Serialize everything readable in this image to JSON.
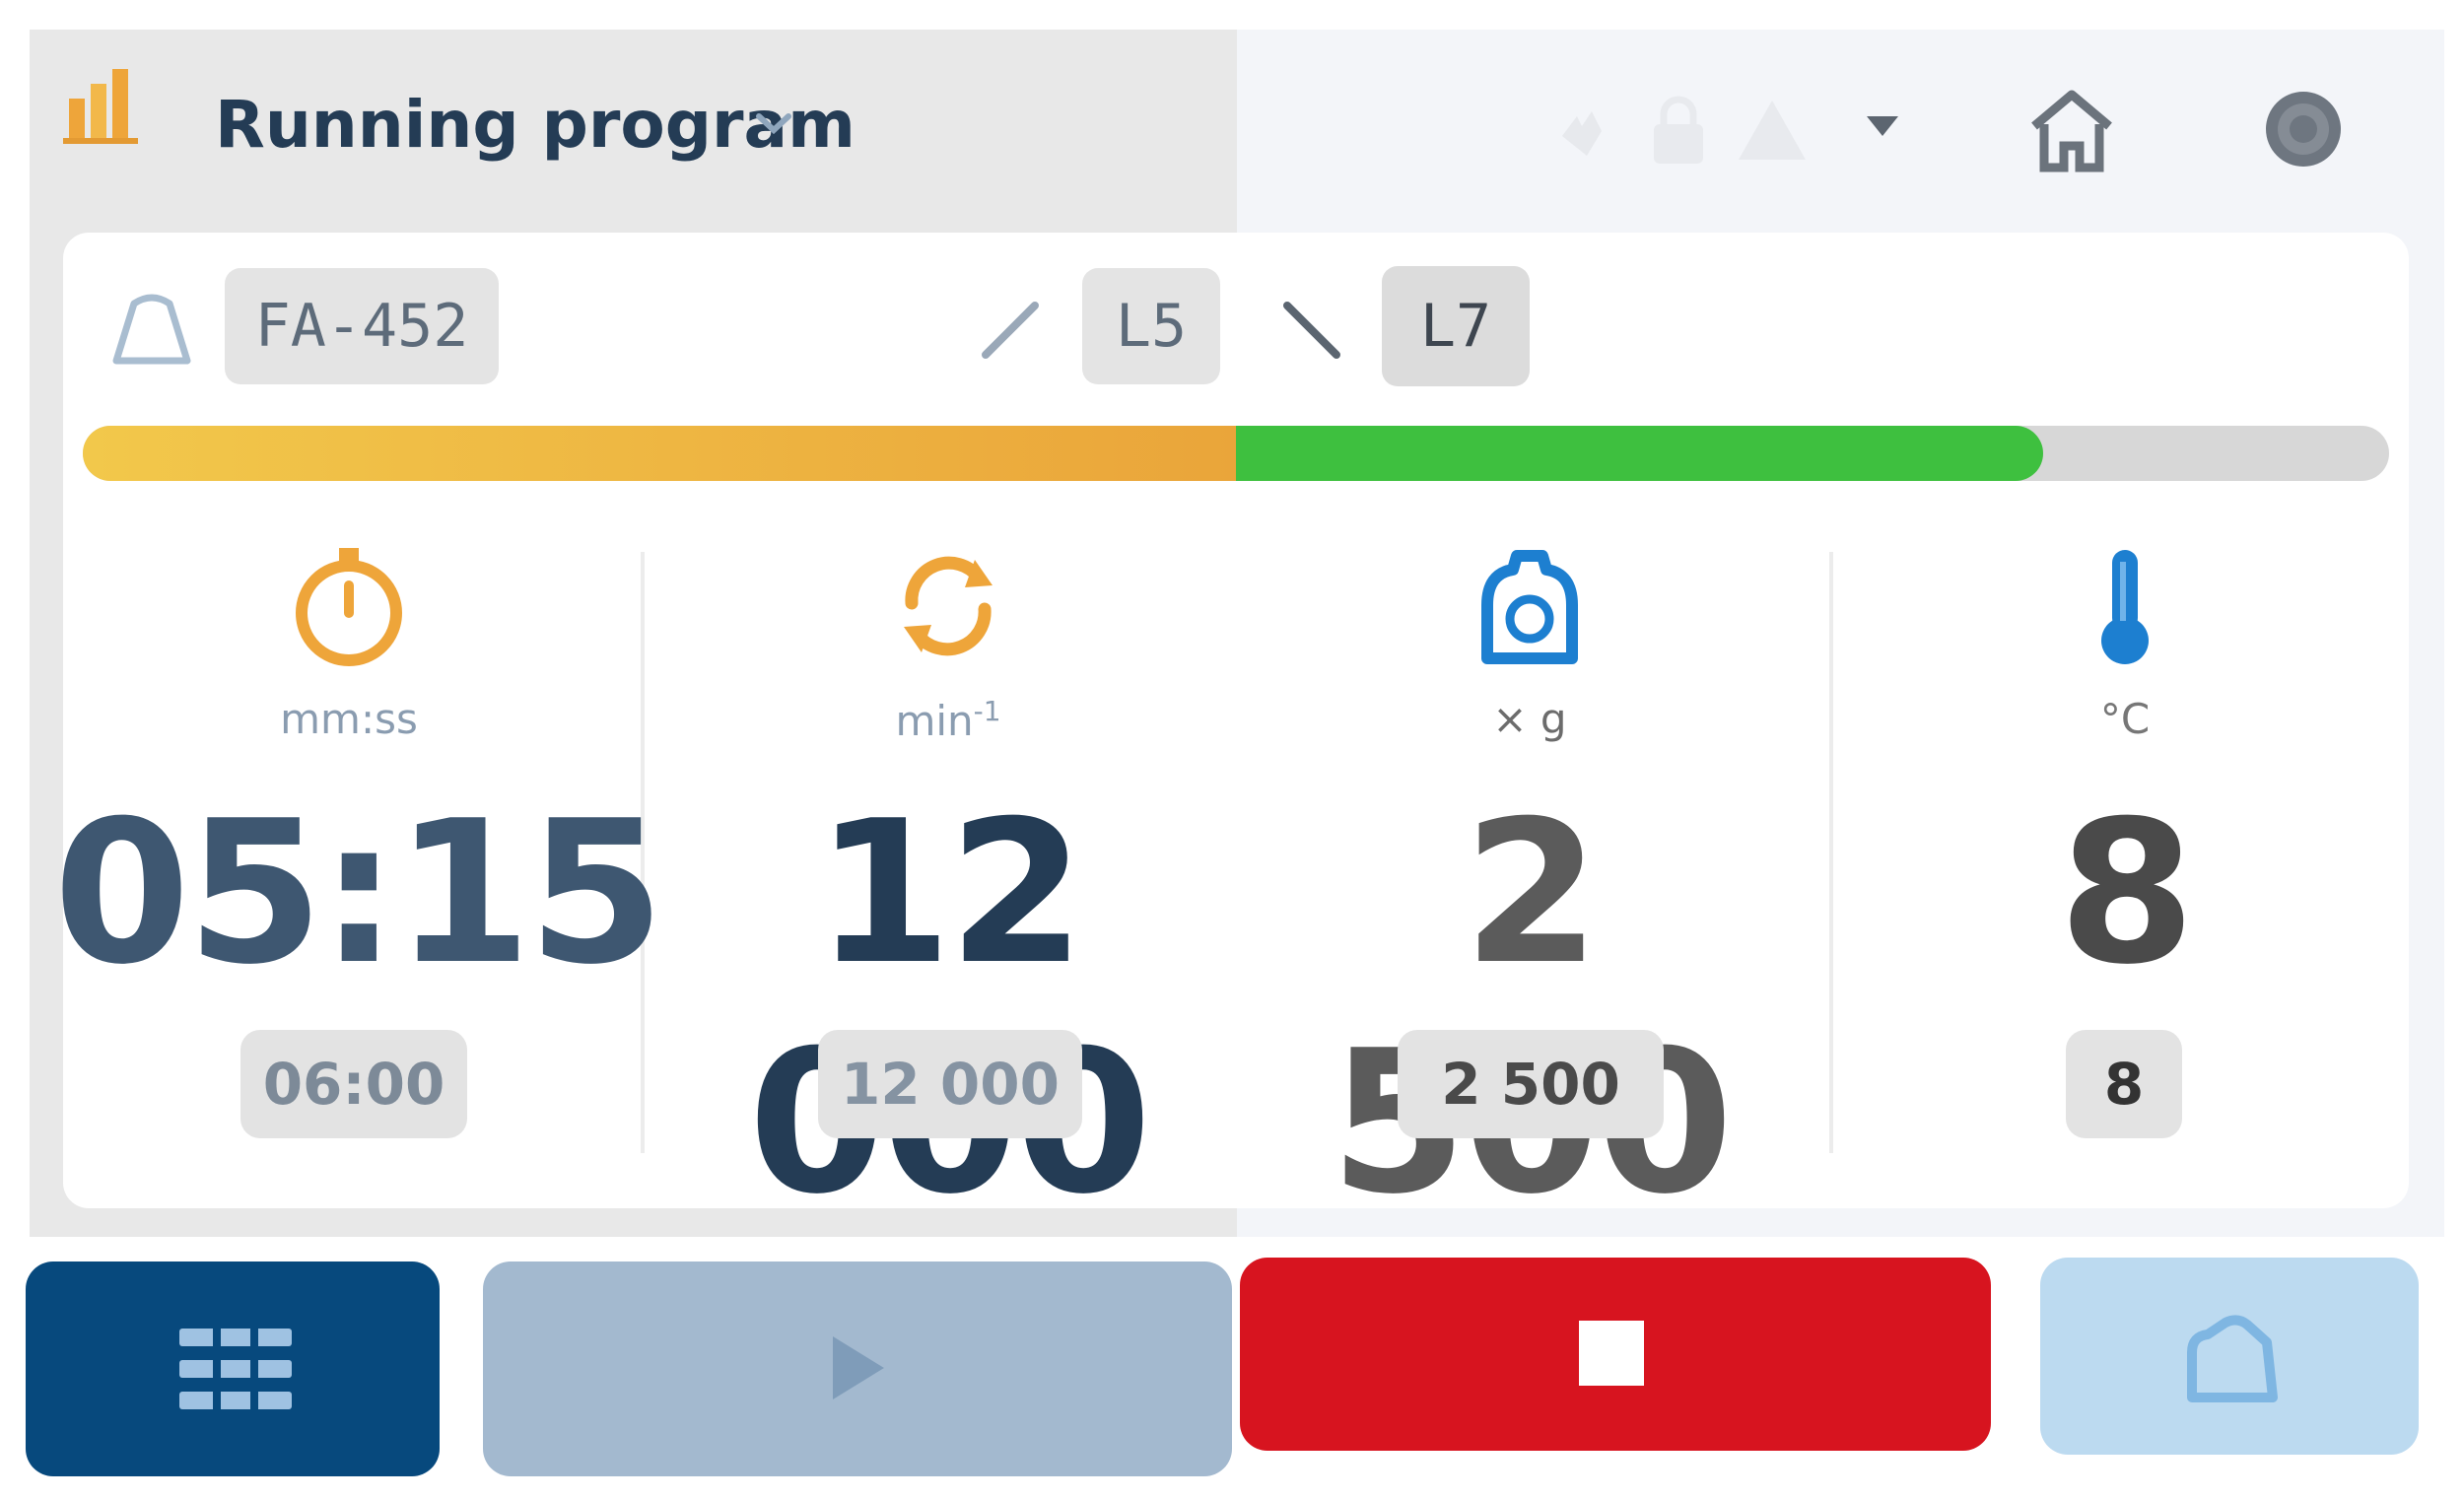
{
  "header": {
    "title": "Running program",
    "icons": [
      "program-chart-icon",
      "chevron-down-icon",
      "hand-icon",
      "lock-icon",
      "warning-icon",
      "dropdown-arrow-icon",
      "home-icon",
      "settings-icon"
    ]
  },
  "rotor": {
    "name": "FA-452",
    "accel_level": "L5",
    "decel_level": "L7"
  },
  "progress": {
    "accel_fraction": 0.5,
    "run_fraction": 0.85,
    "colors": {
      "accel_start": "#f2c84b",
      "accel_end": "#eaa53a",
      "run": "#3ec03f",
      "track": "#d7d7d7"
    }
  },
  "metrics": {
    "time": {
      "unit": "mm:ss",
      "value": "05:15",
      "target": "06:00",
      "color": "#3e5771",
      "icon": "timer-icon"
    },
    "speed": {
      "unit": "min",
      "unit_sup": "-1",
      "value": "12 000",
      "target": "12 000",
      "color": "#243c55",
      "icon": "rotation-icon"
    },
    "rcf": {
      "unit": "× g",
      "value": "2 500",
      "target": "2 500",
      "color": "#5b5b5b",
      "icon": "rcf-icon"
    },
    "temp": {
      "unit": "°C",
      "value": "8",
      "target": "8",
      "color": "#4a4a4a",
      "icon": "thermometer-icon"
    }
  },
  "actions": {
    "menu_icon": "program-list-icon",
    "start_icon": "play-icon",
    "stop_icon": "stop-icon",
    "open_icon": "lid-open-icon"
  },
  "colors": {
    "accent_orange": "#eea53a",
    "accent_blue": "#1d7fd0",
    "menu_button": "#07497d",
    "start_button": "#a3b9cf",
    "stop_button": "#d7141f",
    "open_button": "#bcdaf0"
  }
}
